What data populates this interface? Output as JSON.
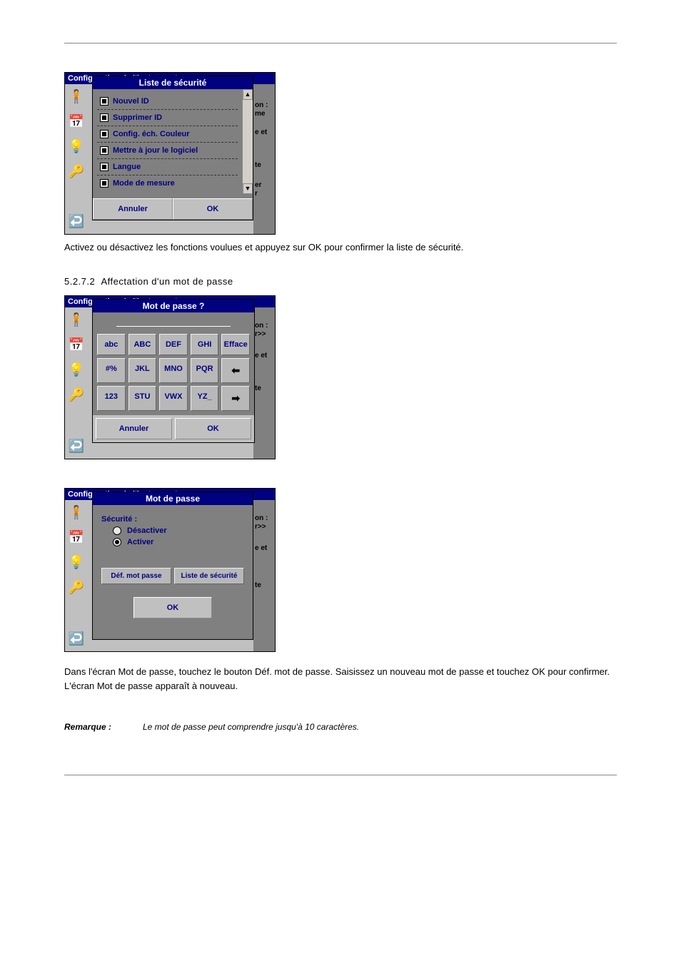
{
  "page_title_partial": "Configuration de l'instrument",
  "section1": {
    "body": "Activez ou désactivez les fonctions voulues et appuyez sur OK pour confirmer la liste de sécurité."
  },
  "section2": {
    "number": "5.2.7.2",
    "title": "Affectation d'un mot de passe",
    "body": "Dans l'écran Mot de passe, touchez le bouton Déf. mot de passe. Saisissez un nouveau mot de passe et touchez OK pour confirmer. L'écran Mot de passe apparaît à nouveau.",
    "note_label": "Remarque :",
    "note_body": "Le mot de passe peut comprendre jusqu'à 10 caractères."
  },
  "shot1": {
    "dialog_title": "Liste de sécurité",
    "items": [
      "Nouvel ID",
      "Supprimer ID",
      "Config. éch. Couleur",
      "Mettre à jour le logiciel",
      "Langue",
      "Mode de mesure"
    ],
    "btn_cancel": "Annuler",
    "btn_ok": "OK",
    "right_frags": {
      "a": "on :",
      "b": "me",
      "c": "e et",
      "d": "te",
      "e": "er",
      "f": "r"
    }
  },
  "shot2": {
    "dialog_title": "Mot de passe ?",
    "keys": [
      [
        "abc",
        "ABC",
        "DEF",
        "GHI",
        "Efface"
      ],
      [
        "#%",
        "JKL",
        "MNO",
        "PQR",
        "←"
      ],
      [
        "123",
        "STU",
        "VWX",
        "YZ_",
        "→"
      ]
    ],
    "btn_cancel": "Annuler",
    "btn_ok": "OK",
    "right_frags": {
      "a": "on :",
      "b": "r>>",
      "c": "e et",
      "d": "te"
    }
  },
  "shot3": {
    "dialog_title": "Mot de passe",
    "label_security": "Sécurité :",
    "radio_off": "Désactiver",
    "radio_on": "Activer",
    "btn_setpw": "Déf. mot passe",
    "btn_seclist": "Liste de sécurité",
    "btn_ok": "OK",
    "right_frags": {
      "a": "on :",
      "b": "r>>",
      "c": "e et",
      "d": "te"
    }
  }
}
